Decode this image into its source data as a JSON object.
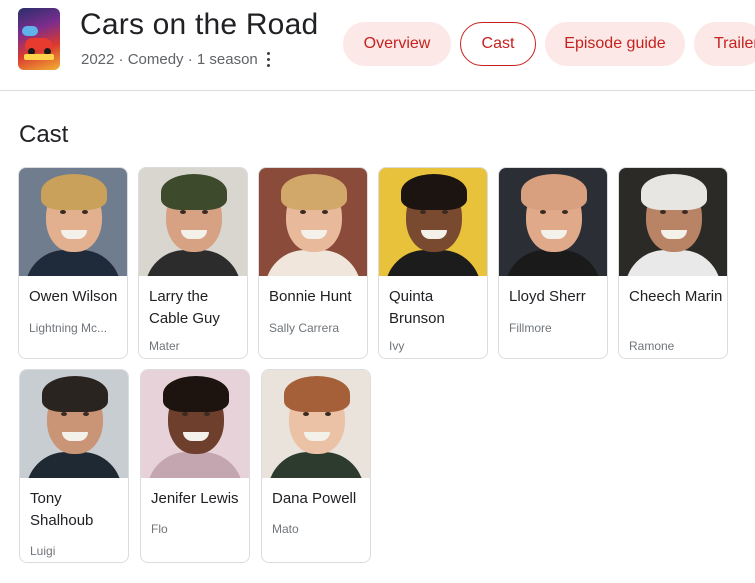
{
  "header": {
    "title": "Cars on the Road",
    "meta": "2022 · Comedy · 1 season",
    "poster_icon": "show-poster"
  },
  "tabs": [
    {
      "label": "Overview",
      "active": false
    },
    {
      "label": "Cast",
      "active": true
    },
    {
      "label": "Episode guide",
      "active": false
    },
    {
      "label": "Trailers",
      "active": false
    }
  ],
  "section": {
    "title": "Cast"
  },
  "cast": [
    {
      "name": "Owen Wilson",
      "role": "Lightning Mc...",
      "bg": "#6f7d8e",
      "skin": "#e2b08e",
      "hair": "#c9a15a",
      "shirt": "#1f2a3a"
    },
    {
      "name": "Larry the Cable Guy",
      "role": "Mater",
      "bg": "#d9d6d0",
      "skin": "#d7a184",
      "hair": "#3d4a2c",
      "shirt": "#2c2c2c"
    },
    {
      "name": "Bonnie Hunt",
      "role": "Sally Carrera",
      "bg": "#8a4b3a",
      "skin": "#e8b99a",
      "hair": "#d2a86a",
      "shirt": "#f0e6dc"
    },
    {
      "name": "Quinta Brunson",
      "role": "Ivy",
      "bg": "#e8c23a",
      "skin": "#7a4a30",
      "hair": "#1c1410",
      "shirt": "#1c1c1c"
    },
    {
      "name": "Lloyd Sherr",
      "role": "Fillmore",
      "bg": "#2b2e35",
      "skin": "#e0a98a",
      "hair": "#d8a07f",
      "shirt": "#1a1a1a"
    },
    {
      "name": "Cheech Marin",
      "role": "Ramone",
      "bg": "#2c2a26",
      "skin": "#b98466",
      "hair": "#e8e6e2",
      "shirt": "#e9e9e9"
    },
    {
      "name": "Tony Shalhoub",
      "role": "Luigi",
      "bg": "#c8cdd2",
      "skin": "#c99576",
      "hair": "#2a2420",
      "shirt": "#1f2933"
    },
    {
      "name": "Jenifer Lewis",
      "role": "Flo",
      "bg": "#e6d2d8",
      "skin": "#6d3f2c",
      "hair": "#1d1410",
      "shirt": "#c4a6b0"
    },
    {
      "name": "Dana Powell",
      "role": "Mato",
      "bg": "#e9e3dc",
      "skin": "#ecc2a6",
      "hair": "#a5603a",
      "shirt": "#2d3a2e"
    }
  ]
}
